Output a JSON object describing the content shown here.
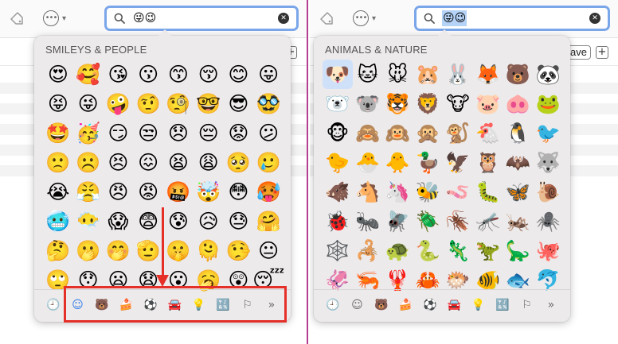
{
  "left": {
    "search": {
      "text": "😜😉"
    },
    "picker": {
      "section_title": "SMILEYS & PEOPLE",
      "emojis": [
        "😍",
        "🥰",
        "😘",
        "😗",
        "😙",
        "😚",
        "😊",
        "😛",
        "😝",
        "😜",
        "🤪",
        "🤨",
        "🧐",
        "🤓",
        "😎",
        "🥸",
        "🤩",
        "🥳",
        "😏",
        "😒",
        "😞",
        "😔",
        "😟",
        "😕",
        "🙁",
        "☹️",
        "😣",
        "😖",
        "😫",
        "😩",
        "🥺",
        "🥲",
        "😭",
        "😤",
        "😠",
        "😡",
        "🤬",
        "🤯",
        "😳",
        "🥵",
        "🥶",
        "😶‍🌫️",
        "😱",
        "😨",
        "😰",
        "😥",
        "😓",
        "🤗",
        "🤔",
        "🫢",
        "🤭",
        "🫡",
        "🤫",
        "🫠",
        "🤥",
        "😐",
        "🙄",
        "😯",
        "😦",
        "😧",
        "😮",
        "🥱",
        "😲",
        "😴"
      ],
      "categories": [
        {
          "name": "recent",
          "glyph": "🕘"
        },
        {
          "name": "smileys",
          "glyph": "☺"
        },
        {
          "name": "animals",
          "glyph": "🐻"
        },
        {
          "name": "food",
          "glyph": "🍰"
        },
        {
          "name": "activity",
          "glyph": "⚽"
        },
        {
          "name": "travel",
          "glyph": "🚘"
        },
        {
          "name": "objects",
          "glyph": "💡"
        },
        {
          "name": "symbols",
          "glyph": "🔣"
        },
        {
          "name": "flags",
          "glyph": "⚐"
        },
        {
          "name": "more",
          "glyph": "»"
        }
      ],
      "active_category": "smileys"
    }
  },
  "right": {
    "search": {
      "text": "😜😉"
    },
    "save_label": "Save",
    "plus_label": "+",
    "picker": {
      "section_title": "ANIMALS & NATURE",
      "emojis": [
        "🐶",
        "🐱",
        "🐭",
        "🐹",
        "🐰",
        "🦊",
        "🐻",
        "🐼",
        "🐻‍❄️",
        "🐨",
        "🐯",
        "🦁",
        "🐮",
        "🐷",
        "🐽",
        "🐸",
        "🐵",
        "🙈",
        "🙉",
        "🙊",
        "🐒",
        "🐔",
        "🐧",
        "🐦",
        "🐤",
        "🐣",
        "🐥",
        "🦆",
        "🦅",
        "🦉",
        "🦇",
        "🐺",
        "🐗",
        "🐴",
        "🦄",
        "🐝",
        "🪱",
        "🐛",
        "🦋",
        "🐌",
        "🐞",
        "🐜",
        "🪰",
        "🪲",
        "🪳",
        "🦟",
        "🦗",
        "🕷️",
        "🕸️",
        "🦂",
        "🐢",
        "🐍",
        "🦎",
        "🦖",
        "🦕",
        "🐙",
        "🦑",
        "🦐",
        "🦞",
        "🦀",
        "🐡",
        "🐠",
        "🐟",
        "🐬"
      ],
      "categories": [
        {
          "name": "recent",
          "glyph": "🕘"
        },
        {
          "name": "smileys",
          "glyph": "☺"
        },
        {
          "name": "animals",
          "glyph": "🐻"
        },
        {
          "name": "food",
          "glyph": "🍰"
        },
        {
          "name": "activity",
          "glyph": "⚽"
        },
        {
          "name": "travel",
          "glyph": "🚘"
        },
        {
          "name": "objects",
          "glyph": "💡"
        },
        {
          "name": "symbols",
          "glyph": "🔣"
        },
        {
          "name": "flags",
          "glyph": "⚐"
        },
        {
          "name": "more",
          "glyph": "»"
        }
      ],
      "active_category": "animals"
    }
  },
  "colors": {
    "accent": "#2f7be8",
    "search_border": "#7aa6ea",
    "annotation_red": "#e5302a",
    "window_divider": "#b43e8f"
  },
  "icons": {
    "tag": "tag-icon",
    "more": "ellipsis-circle-icon",
    "search": "magnifying-glass-icon",
    "clear": "clear-circle-icon",
    "annotation_arrow": "down-arrow-icon"
  }
}
